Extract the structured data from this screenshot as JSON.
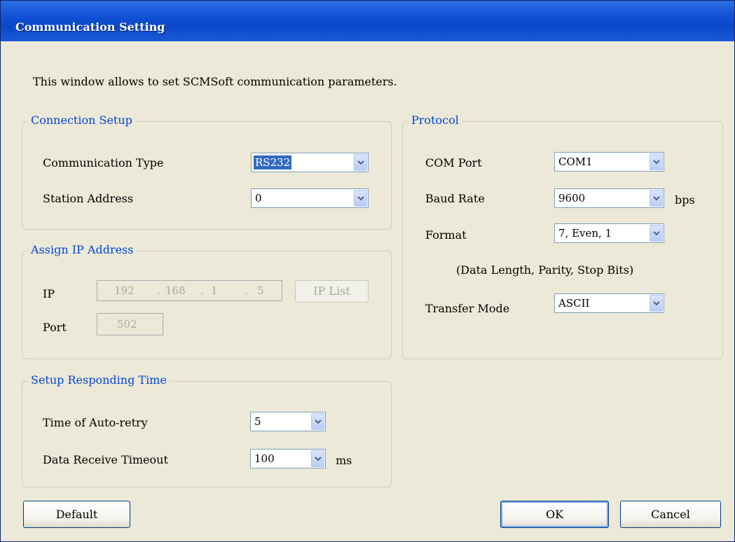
{
  "window": {
    "title": "Communication Setting"
  },
  "description": "This window allows to set  SCMSoft communication parameters.",
  "connection_setup": {
    "legend": "Connection Setup",
    "comm_type_label": "Communication Type",
    "comm_type_value": "RS232",
    "station_address_label": "Station Address",
    "station_address_value": "0"
  },
  "assign_ip": {
    "legend": "Assign IP Address",
    "ip_label": "IP",
    "ip_octets": [
      "192",
      "168",
      "1",
      "5"
    ],
    "ip_dot": ".",
    "ip_list_button": "IP List",
    "port_label": "Port",
    "port_value": "502"
  },
  "responding_time": {
    "legend": "Setup Responding Time",
    "auto_retry_label": "Time of Auto-retry",
    "auto_retry_value": "5",
    "timeout_label": "Data Receive Timeout",
    "timeout_value": "100",
    "timeout_unit": "ms"
  },
  "protocol": {
    "legend": "Protocol",
    "com_port_label": "COM Port",
    "com_port_value": "COM1",
    "baud_rate_label": "Baud Rate",
    "baud_rate_value": "9600",
    "baud_rate_unit": "bps",
    "format_label": "Format",
    "format_value": "7, Even, 1",
    "format_hint": "(Data Length, Parity, Stop Bits)",
    "transfer_mode_label": "Transfer Mode",
    "transfer_mode_value": "ASCII"
  },
  "buttons": {
    "default": "Default",
    "ok": "OK",
    "cancel": "Cancel"
  },
  "colors": {
    "legend": "#0046d5",
    "titlebar": "#0a47c9",
    "selection": "#316ac5",
    "background": "#ece9d8"
  }
}
